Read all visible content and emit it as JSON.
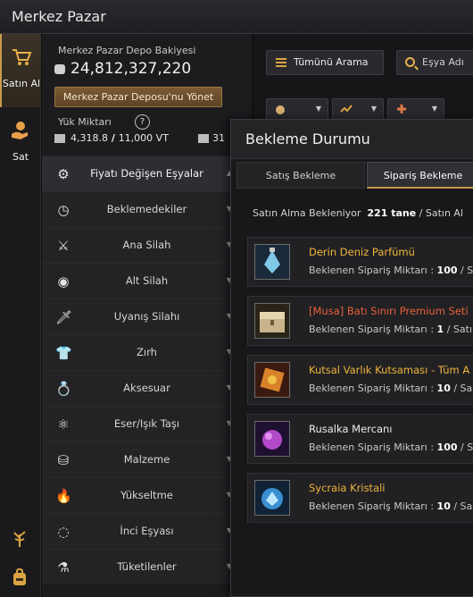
{
  "window": {
    "title": "Merkez Pazar"
  },
  "rail": {
    "buy_label": "Satın Al",
    "sell_label": "Sat"
  },
  "wallet": {
    "balance_label": "Merkez Pazar Depo Bakiyesi",
    "balance_value": "24,812,327,220",
    "manage_button": "Merkez Pazar Deposu'nu Yönet",
    "weight_label": "Yük Miktarı",
    "help_glyph": "?",
    "weight_current": "4,318.8",
    "weight_sep": " / ",
    "weight_max": "11,000 VT",
    "extra_value": "31"
  },
  "categories": [
    {
      "label": "Fiyatı Değişen Eşyalar",
      "icon": "gear-icon",
      "glyph": "⚙",
      "active": true
    },
    {
      "label": "Beklemedekiler",
      "icon": "clock-icon",
      "glyph": "◷"
    },
    {
      "label": "Ana Silah",
      "icon": "sword-icon",
      "glyph": "⚔"
    },
    {
      "label": "Alt Silah",
      "icon": "shield-icon",
      "glyph": "◉"
    },
    {
      "label": "Uyanış Silahı",
      "icon": "dagger-icon",
      "glyph": "🗡"
    },
    {
      "label": "Zırh",
      "icon": "armor-icon",
      "glyph": "👕"
    },
    {
      "label": "Aksesuar",
      "icon": "ring-icon",
      "glyph": "💍"
    },
    {
      "label": "Eser/Işık Taşı",
      "icon": "artifact-icon",
      "glyph": "⚛"
    },
    {
      "label": "Malzeme",
      "icon": "material-icon",
      "glyph": "⛁"
    },
    {
      "label": "Yükseltme",
      "icon": "flame-icon",
      "glyph": "🔥"
    },
    {
      "label": "İnci Eşyası",
      "icon": "pearl-icon",
      "glyph": "◌"
    },
    {
      "label": "Tüketilenler",
      "icon": "potion-icon",
      "glyph": "⚗"
    }
  ],
  "toolbar": {
    "search_all_label": "Tümünü Arama",
    "item_search_placeholder": "Eşya Adı"
  },
  "modal": {
    "title": "Bekleme Durumu",
    "tab_sell": "Satış Bekleme",
    "tab_order": "Sipariş Bekleme",
    "status_prefix": "Satın Alma Bekleniyor",
    "status_count": "221 tane",
    "status_sep": " / ",
    "status_suffix": "Satın Al"
  },
  "orders": [
    {
      "name": "Derin Deniz Parfümü",
      "color": "#f0b43a",
      "qty_label": "Beklenen Sipariş Miktarı : ",
      "qty": "100",
      "tail": " / S",
      "icon": "perfume-icon"
    },
    {
      "name": "[Musa] Batı Sınırı Premium Seti",
      "color": "#e8603a",
      "qty_label": "Beklenen Sipariş Miktarı : ",
      "qty": "1",
      "tail": " / Satı",
      "icon": "chest-icon"
    },
    {
      "name": "Kutsal Varlık Kutsaması - Tüm A",
      "color": "#f0b43a",
      "qty_label": "Beklenen Sipariş Miktarı : ",
      "qty": "10",
      "tail": " / Sa",
      "icon": "scroll-icon"
    },
    {
      "name": "Rusalka Mercanı",
      "color": "#ececec",
      "qty_label": "Beklenen Sipariş Miktarı : ",
      "qty": "100",
      "tail": " / S",
      "icon": "coral-icon"
    },
    {
      "name": "Sycraia Kristali",
      "color": "#f0b43a",
      "qty_label": "Beklenen Sipariş Miktarı : ",
      "qty": "10",
      "tail": " / Sa",
      "icon": "crystal-icon"
    }
  ],
  "colors": {
    "accent": "#c89a4a",
    "gold_text": "#f0b43a",
    "red_text": "#e8603a"
  }
}
